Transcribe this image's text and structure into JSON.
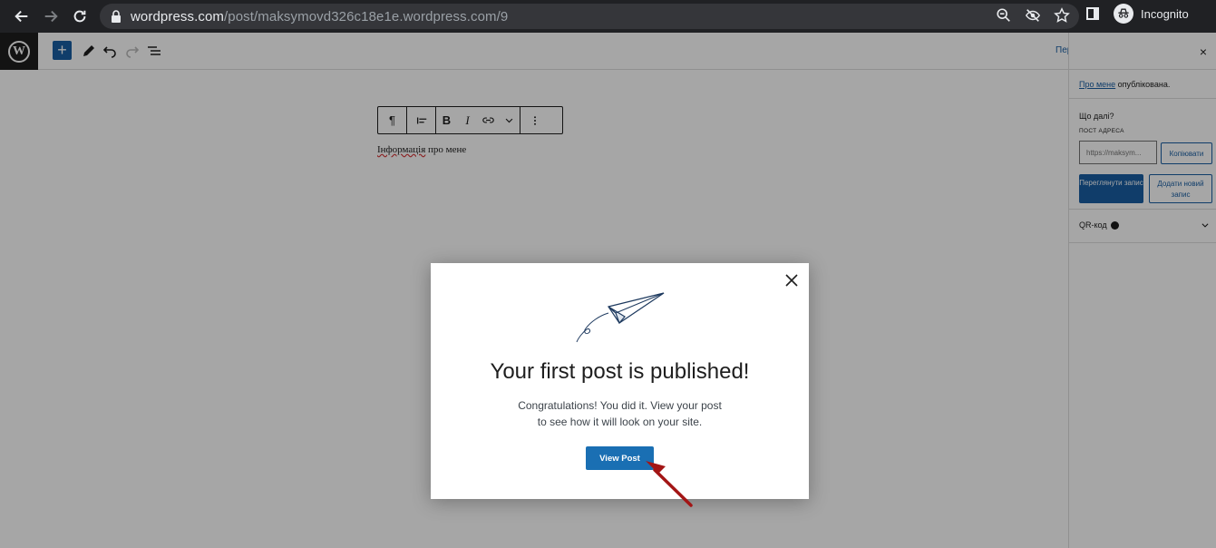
{
  "browser": {
    "url_host": "wordpress.com",
    "url_path": "/post/maksymovd326c18e1e.wordpress.com/9",
    "profile_label": "Incognito"
  },
  "editor": {
    "cut_label": "Пер",
    "post_text_word1": "Інформація",
    "post_text_rest": " про мене",
    "block_toolbar": {
      "paragraph_glyph": "¶",
      "bold_glyph": "B",
      "italic_glyph": "I"
    }
  },
  "sidebar": {
    "close_glyph": "×",
    "post_link": "Про мене",
    "post_status": " опублікована.",
    "whats_next": "Що далі?",
    "post_address_label": "ПОСТ АДРЕСА",
    "address_value": "https://maksym...",
    "copy_label": "Копіювати",
    "view_post_label": "Переглянути запис",
    "add_new_label": "Додати новий запис",
    "qr_label": "QR-код"
  },
  "modal": {
    "title": "Your first post is published!",
    "body_line1": "Congratulations! You did it. View your post",
    "body_line2": "to see how it will look on your site.",
    "button_label": "View Post"
  },
  "colors": {
    "wp_blue": "#1a5fa3",
    "annotation_arrow": "#a31515"
  }
}
